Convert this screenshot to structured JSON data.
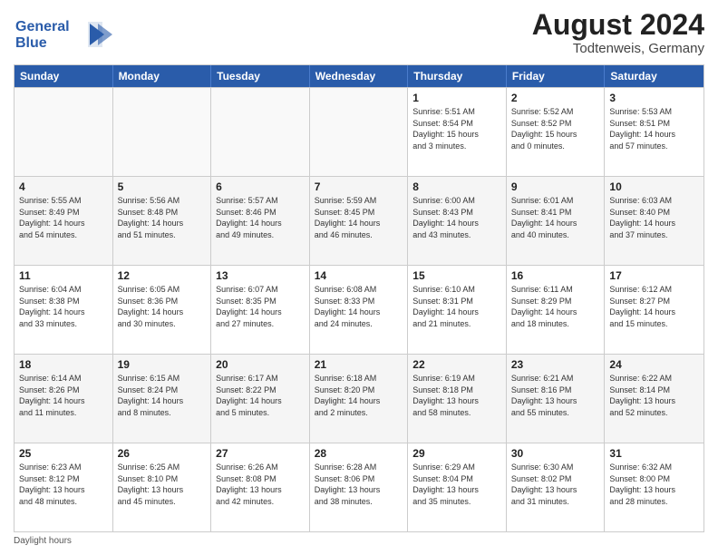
{
  "header": {
    "logo_line1": "General",
    "logo_line2": "Blue",
    "month": "August 2024",
    "location": "Todtenweis, Germany"
  },
  "days_of_week": [
    "Sunday",
    "Monday",
    "Tuesday",
    "Wednesday",
    "Thursday",
    "Friday",
    "Saturday"
  ],
  "footer": "Daylight hours",
  "weeks": [
    [
      {
        "day": "",
        "info": ""
      },
      {
        "day": "",
        "info": ""
      },
      {
        "day": "",
        "info": ""
      },
      {
        "day": "",
        "info": ""
      },
      {
        "day": "1",
        "info": "Sunrise: 5:51 AM\nSunset: 8:54 PM\nDaylight: 15 hours\nand 3 minutes."
      },
      {
        "day": "2",
        "info": "Sunrise: 5:52 AM\nSunset: 8:52 PM\nDaylight: 15 hours\nand 0 minutes."
      },
      {
        "day": "3",
        "info": "Sunrise: 5:53 AM\nSunset: 8:51 PM\nDaylight: 14 hours\nand 57 minutes."
      }
    ],
    [
      {
        "day": "4",
        "info": "Sunrise: 5:55 AM\nSunset: 8:49 PM\nDaylight: 14 hours\nand 54 minutes."
      },
      {
        "day": "5",
        "info": "Sunrise: 5:56 AM\nSunset: 8:48 PM\nDaylight: 14 hours\nand 51 minutes."
      },
      {
        "day": "6",
        "info": "Sunrise: 5:57 AM\nSunset: 8:46 PM\nDaylight: 14 hours\nand 49 minutes."
      },
      {
        "day": "7",
        "info": "Sunrise: 5:59 AM\nSunset: 8:45 PM\nDaylight: 14 hours\nand 46 minutes."
      },
      {
        "day": "8",
        "info": "Sunrise: 6:00 AM\nSunset: 8:43 PM\nDaylight: 14 hours\nand 43 minutes."
      },
      {
        "day": "9",
        "info": "Sunrise: 6:01 AM\nSunset: 8:41 PM\nDaylight: 14 hours\nand 40 minutes."
      },
      {
        "day": "10",
        "info": "Sunrise: 6:03 AM\nSunset: 8:40 PM\nDaylight: 14 hours\nand 37 minutes."
      }
    ],
    [
      {
        "day": "11",
        "info": "Sunrise: 6:04 AM\nSunset: 8:38 PM\nDaylight: 14 hours\nand 33 minutes."
      },
      {
        "day": "12",
        "info": "Sunrise: 6:05 AM\nSunset: 8:36 PM\nDaylight: 14 hours\nand 30 minutes."
      },
      {
        "day": "13",
        "info": "Sunrise: 6:07 AM\nSunset: 8:35 PM\nDaylight: 14 hours\nand 27 minutes."
      },
      {
        "day": "14",
        "info": "Sunrise: 6:08 AM\nSunset: 8:33 PM\nDaylight: 14 hours\nand 24 minutes."
      },
      {
        "day": "15",
        "info": "Sunrise: 6:10 AM\nSunset: 8:31 PM\nDaylight: 14 hours\nand 21 minutes."
      },
      {
        "day": "16",
        "info": "Sunrise: 6:11 AM\nSunset: 8:29 PM\nDaylight: 14 hours\nand 18 minutes."
      },
      {
        "day": "17",
        "info": "Sunrise: 6:12 AM\nSunset: 8:27 PM\nDaylight: 14 hours\nand 15 minutes."
      }
    ],
    [
      {
        "day": "18",
        "info": "Sunrise: 6:14 AM\nSunset: 8:26 PM\nDaylight: 14 hours\nand 11 minutes."
      },
      {
        "day": "19",
        "info": "Sunrise: 6:15 AM\nSunset: 8:24 PM\nDaylight: 14 hours\nand 8 minutes."
      },
      {
        "day": "20",
        "info": "Sunrise: 6:17 AM\nSunset: 8:22 PM\nDaylight: 14 hours\nand 5 minutes."
      },
      {
        "day": "21",
        "info": "Sunrise: 6:18 AM\nSunset: 8:20 PM\nDaylight: 14 hours\nand 2 minutes."
      },
      {
        "day": "22",
        "info": "Sunrise: 6:19 AM\nSunset: 8:18 PM\nDaylight: 13 hours\nand 58 minutes."
      },
      {
        "day": "23",
        "info": "Sunrise: 6:21 AM\nSunset: 8:16 PM\nDaylight: 13 hours\nand 55 minutes."
      },
      {
        "day": "24",
        "info": "Sunrise: 6:22 AM\nSunset: 8:14 PM\nDaylight: 13 hours\nand 52 minutes."
      }
    ],
    [
      {
        "day": "25",
        "info": "Sunrise: 6:23 AM\nSunset: 8:12 PM\nDaylight: 13 hours\nand 48 minutes."
      },
      {
        "day": "26",
        "info": "Sunrise: 6:25 AM\nSunset: 8:10 PM\nDaylight: 13 hours\nand 45 minutes."
      },
      {
        "day": "27",
        "info": "Sunrise: 6:26 AM\nSunset: 8:08 PM\nDaylight: 13 hours\nand 42 minutes."
      },
      {
        "day": "28",
        "info": "Sunrise: 6:28 AM\nSunset: 8:06 PM\nDaylight: 13 hours\nand 38 minutes."
      },
      {
        "day": "29",
        "info": "Sunrise: 6:29 AM\nSunset: 8:04 PM\nDaylight: 13 hours\nand 35 minutes."
      },
      {
        "day": "30",
        "info": "Sunrise: 6:30 AM\nSunset: 8:02 PM\nDaylight: 13 hours\nand 31 minutes."
      },
      {
        "day": "31",
        "info": "Sunrise: 6:32 AM\nSunset: 8:00 PM\nDaylight: 13 hours\nand 28 minutes."
      }
    ]
  ]
}
